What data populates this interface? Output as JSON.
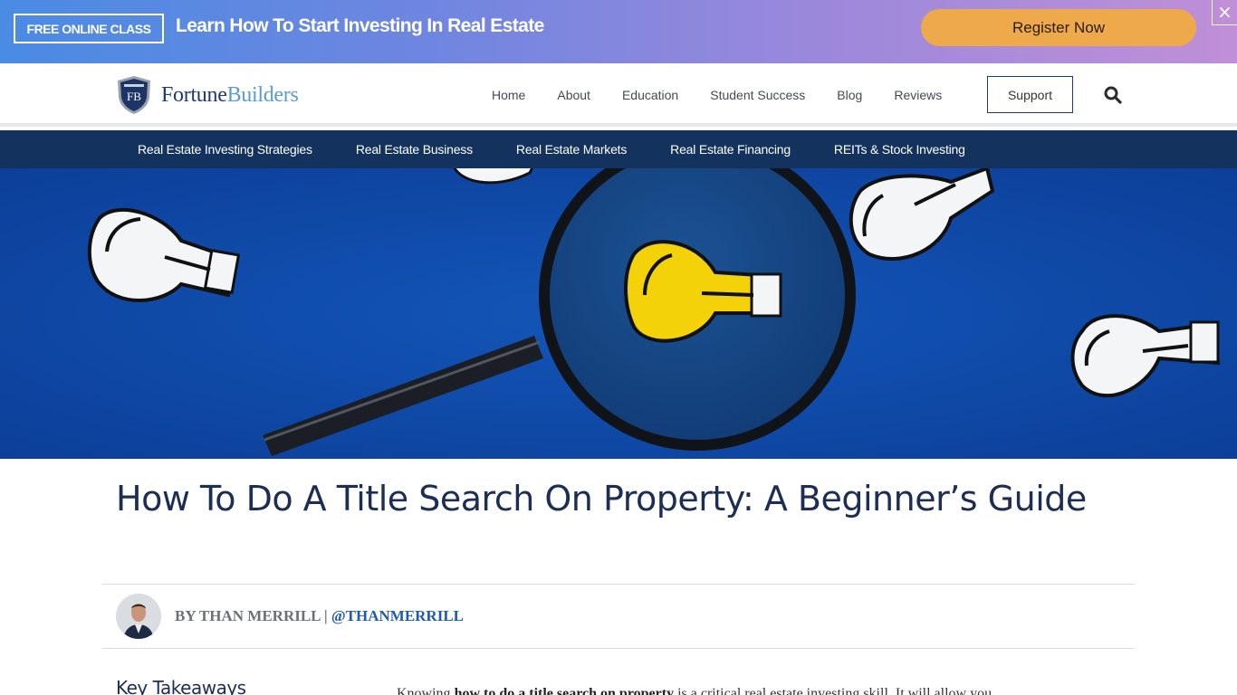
{
  "promo": {
    "badge": "FREE ONLINE CLASS",
    "headline": "Learn How To Start Investing In Real Estate",
    "cta": "Register Now",
    "close": "×",
    "colors": {
      "gradient_start": "#4a8be3",
      "gradient_end": "#c08fd8",
      "cta_bg": "#eeaa4a"
    }
  },
  "header": {
    "logo": {
      "initials": "FB",
      "word1": "Fortune",
      "word2": "Builders"
    },
    "nav": [
      "Home",
      "About",
      "Education",
      "Student Success",
      "Blog",
      "Reviews"
    ],
    "support": "Support",
    "search_icon": "search-icon"
  },
  "subnav": {
    "items": [
      "Real Estate Investing Strategies",
      "Real Estate Business",
      "Real Estate Markets",
      "Real Estate Financing",
      "REITs & Stock Investing"
    ],
    "color": "#13335e"
  },
  "hero": {
    "alt": "Magnifying glass over yellow light bulb surrounded by white light bulbs on blue background"
  },
  "article": {
    "title": "How To Do A Title Search On Property: A Beginner’s Guide",
    "author_prefix": "BY THAN MERRILL",
    "separator": " | ",
    "author_handle": "@THANMERRILL",
    "takeaways_heading": "Key Takeaways",
    "intro_pre": "Knowing ",
    "intro_bold": "how to do a title search on property",
    "intro_post": " is a critical real estate investing skill. It will allow you"
  }
}
